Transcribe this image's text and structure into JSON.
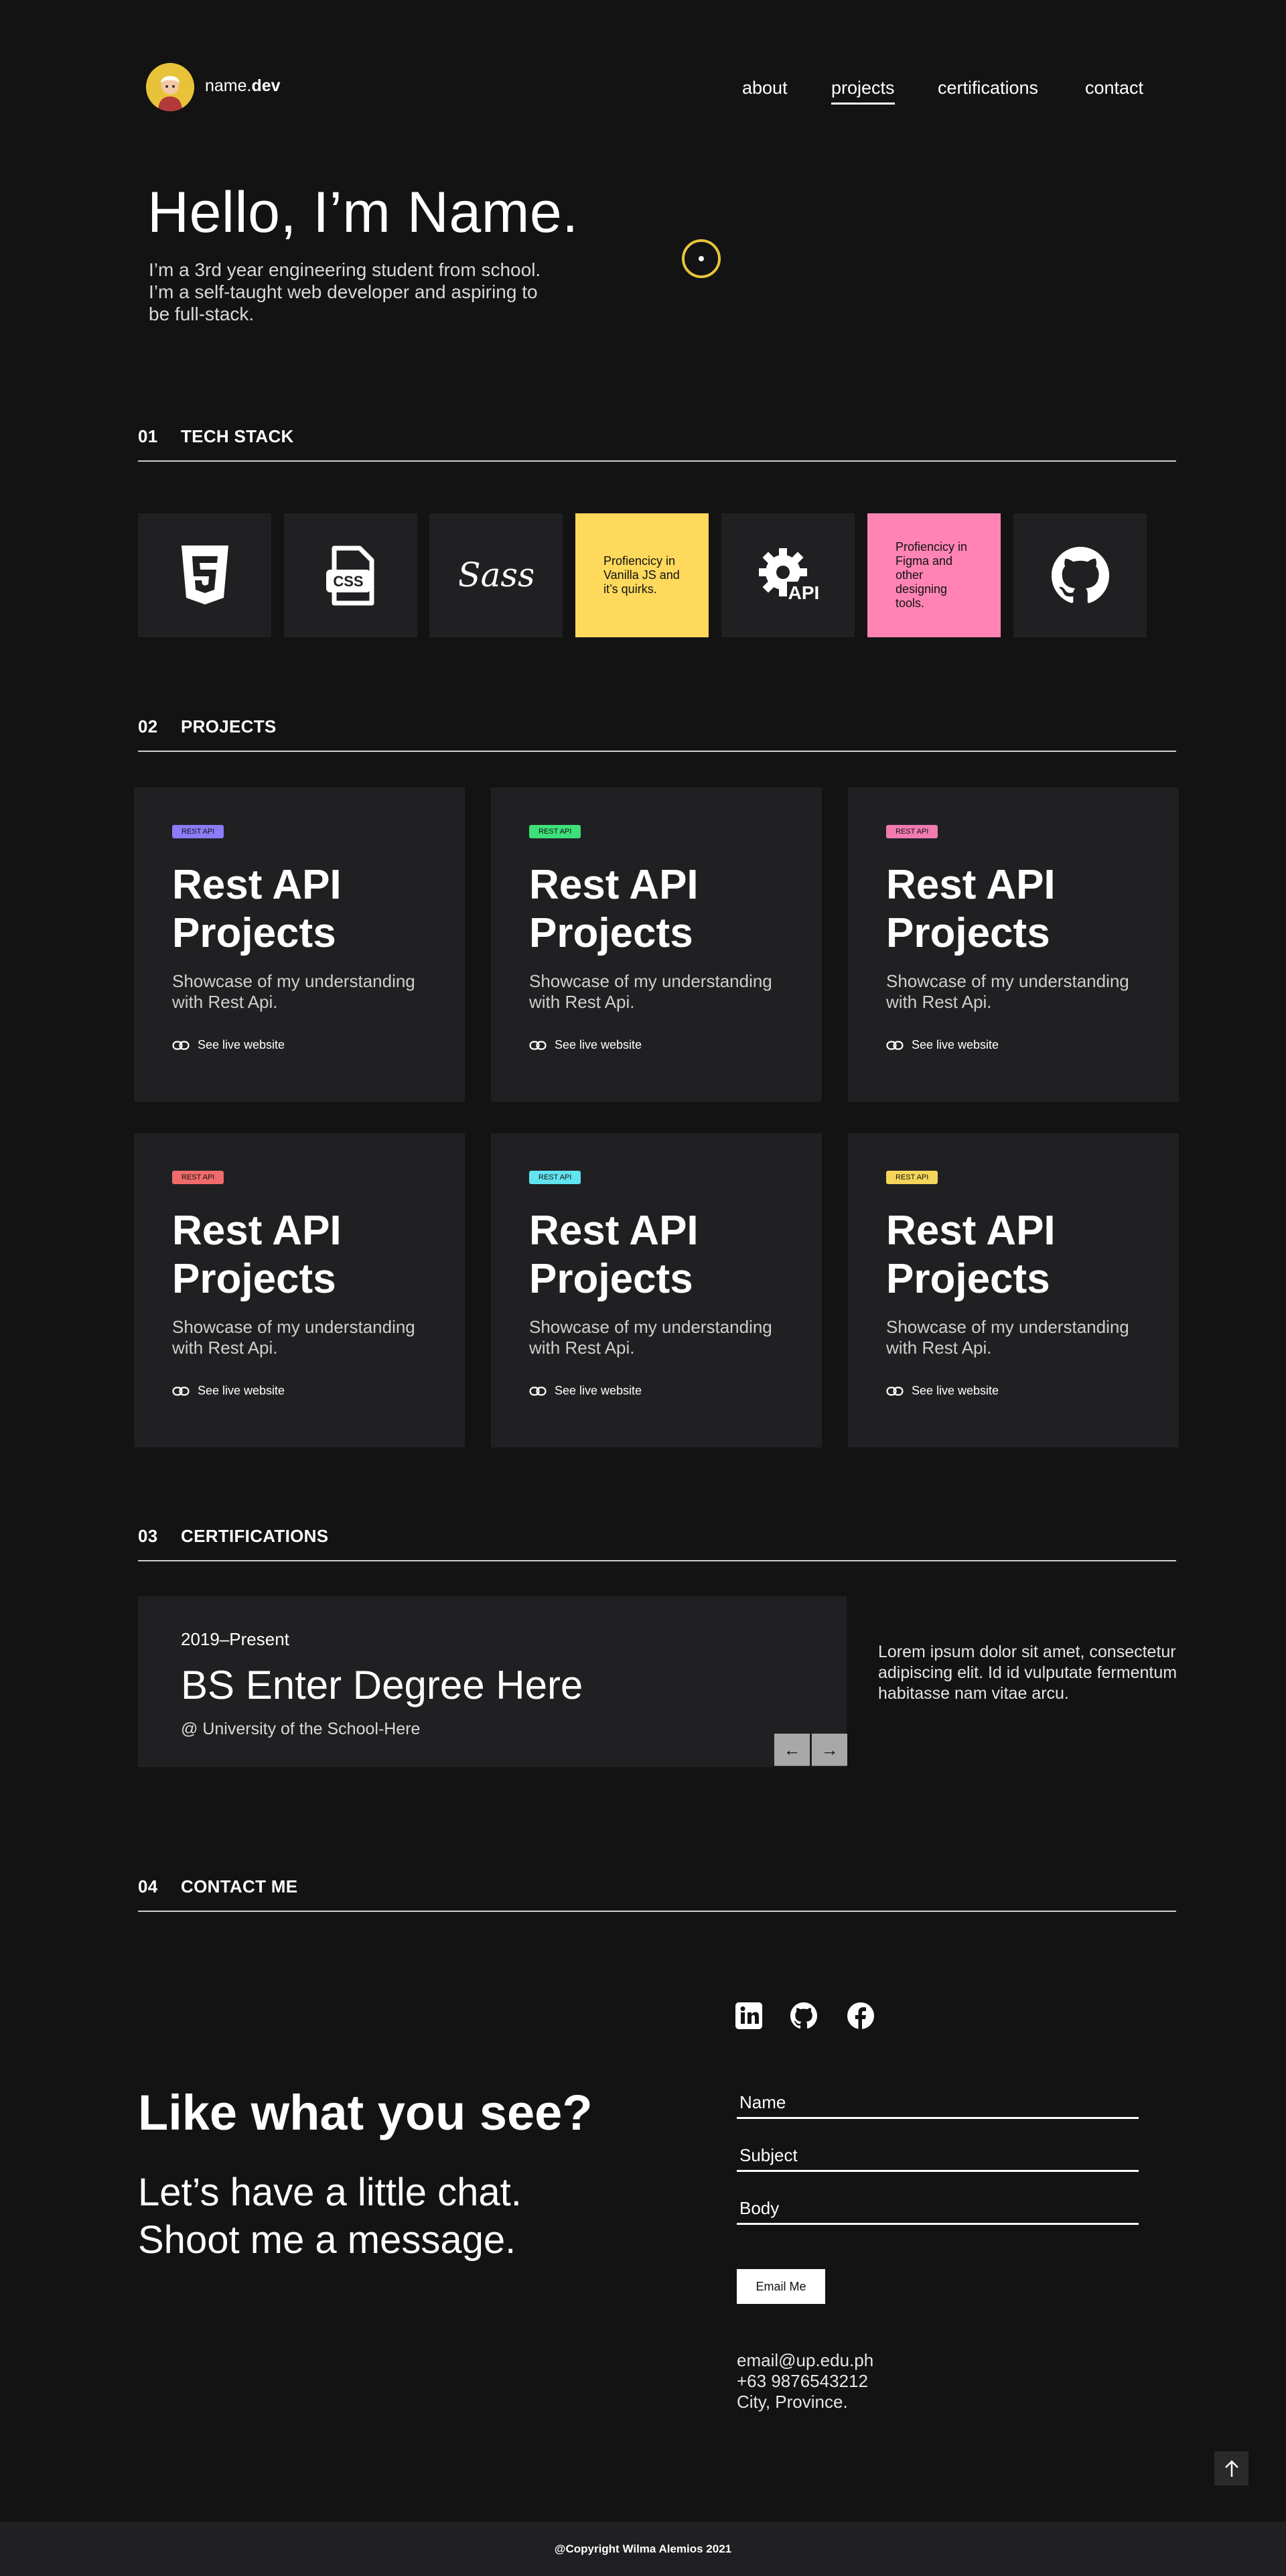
{
  "header": {
    "brand_prefix": "name.",
    "brand_suffix": "dev",
    "nav": [
      "about",
      "projects",
      "certifications",
      "contact"
    ],
    "active_nav": "projects"
  },
  "hero": {
    "title": "Hello, I’m Name.",
    "subtitle": "I’m a 3rd year engineering student from school. I’m a self-taught web developer and aspiring to be full-stack."
  },
  "sections": {
    "tech": {
      "num": "01",
      "title": "TECH STACK"
    },
    "projects": {
      "num": "02",
      "title": "PROJECTS"
    },
    "certs": {
      "num": "03",
      "title": "CERTIFICATIONS"
    },
    "contact": {
      "num": "04",
      "title": "CONTACT ME"
    }
  },
  "tech_stack": {
    "icons": [
      "html5-icon",
      "css-file-icon",
      "sass-icon",
      "api-gear-icon",
      "github-icon"
    ],
    "note_js": "Profiencicy in Vanilla JS and it’s quirks.",
    "note_figma": "Profiencicy in Figma and other designing tools.",
    "api_label": "API",
    "css_label": "CSS",
    "sass_label": "Sass"
  },
  "projects": [
    {
      "tag": "REST API",
      "tag_color": "#8b7cf8",
      "title": "Rest API Projects",
      "desc": "Showcase of my understanding with Rest Api.",
      "link": "See live website"
    },
    {
      "tag": "REST API",
      "tag_color": "#3ee07a",
      "title": "Rest API Projects",
      "desc": "Showcase of my understanding with Rest Api.",
      "link": "See live website"
    },
    {
      "tag": "REST API",
      "tag_color": "#f27bb0",
      "title": "Rest API Projects",
      "desc": "Showcase of my understanding with Rest Api.",
      "link": "See live website"
    },
    {
      "tag": "REST API",
      "tag_color": "#f06b6b",
      "title": "Rest API Projects",
      "desc": "Showcase of my understanding with Rest Api.",
      "link": "See live website"
    },
    {
      "tag": "REST API",
      "tag_color": "#62e3f0",
      "title": "Rest API Projects",
      "desc": "Showcase of my understanding with Rest Api.",
      "link": "See live website"
    },
    {
      "tag": "REST API",
      "tag_color": "#f5d55a",
      "title": "Rest API Projects",
      "desc": "Showcase of my understanding with Rest Api.",
      "link": "See live website"
    }
  ],
  "certification": {
    "year": "2019–Present",
    "degree": "BS Enter Degree Here",
    "school": "@ University of the School-Here",
    "description": "Lorem ipsum dolor sit amet, consectetur adipiscing elit. Id id vulputate fermentum habitasse nam vitae arcu.",
    "prev": "←",
    "next": "→"
  },
  "contact": {
    "headline": "Like what you see?",
    "line1": "Let’s have a little chat.",
    "line2": "Shoot me a message.",
    "socials": [
      "linkedin-icon",
      "github-icon",
      "facebook-icon"
    ],
    "fields": {
      "name": "Name",
      "subject": "Subject",
      "body": "Body"
    },
    "button": "Email Me",
    "email": "email@up.edu.ph",
    "phone": "+63 9876543212",
    "location": "City, Province."
  },
  "footer": {
    "copyright": "@Copyright Wilma Alemios 2021"
  },
  "colors": {
    "background": "#131313",
    "card": "#202023",
    "yellow": "#fed95c",
    "pink": "#ff84b4",
    "accent_ring": "#e6c53c"
  }
}
